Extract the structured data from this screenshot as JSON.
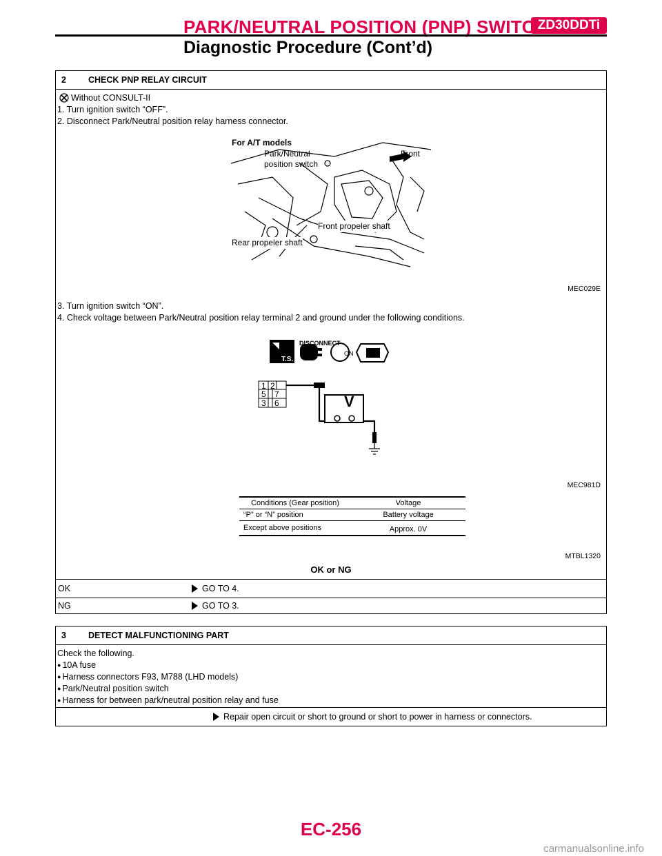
{
  "header": {
    "title": "PARK/NEUTRAL POSITION (PNP) SWITCH",
    "badge": "ZD30DDTi",
    "subtitle": "Diagnostic Procedure (Cont’d)"
  },
  "step2": {
    "number": "2",
    "title": "CHECK PNP RELAY CIRCUIT",
    "mode": "Without CONSULT-II",
    "line1": "1. Turn ignition switch “OFF”.",
    "line2": "2. Disconnect Park/Neutral position relay harness connector.",
    "fig1": {
      "label_models": "For A/T models",
      "label_switch1": "Park/Neutral",
      "label_switch2": "position switch",
      "label_front": "Front",
      "label_front_shaft": "Front propeler shaft",
      "label_rear_shaft": "Rear propeler shaft",
      "caption": "MEC029E"
    },
    "line3": "3. Turn ignition switch “ON”.",
    "line4": "4. Check voltage between Park/Neutral position relay terminal 2 and ground under the following conditions.",
    "fig2": {
      "disconnect": "DISCONNECT",
      "ts": "T.S.",
      "on": "ON",
      "terminals": [
        "1",
        "2",
        "5",
        "7",
        "3",
        "6"
      ],
      "meter": "V",
      "caption": "MEC981D"
    },
    "table": {
      "headers": [
        "Conditions (Gear position)",
        "Voltage"
      ],
      "rows": [
        [
          "“P” or “N” position",
          "Battery voltage"
        ],
        [
          "Except above positions",
          "Approx. 0V"
        ]
      ],
      "caption": "MTBL1320"
    },
    "ok_ng": "OK or NG",
    "results": [
      {
        "label": "OK",
        "action": "GO TO 4."
      },
      {
        "label": "NG",
        "action": "GO TO 3."
      }
    ]
  },
  "step3": {
    "number": "3",
    "title": "DETECT MALFUNCTIONING PART",
    "intro": "Check the following.",
    "bullets": [
      "10A fuse",
      "Harness connectors F93, M788 (LHD models)",
      "Park/Neutral position switch",
      "Harness for between park/neutral position relay and fuse"
    ],
    "action": "Repair open circuit or short to ground or short to power in harness or connectors."
  },
  "footer": {
    "page": "EC-256",
    "watermark": "carmanualsonline.info"
  }
}
